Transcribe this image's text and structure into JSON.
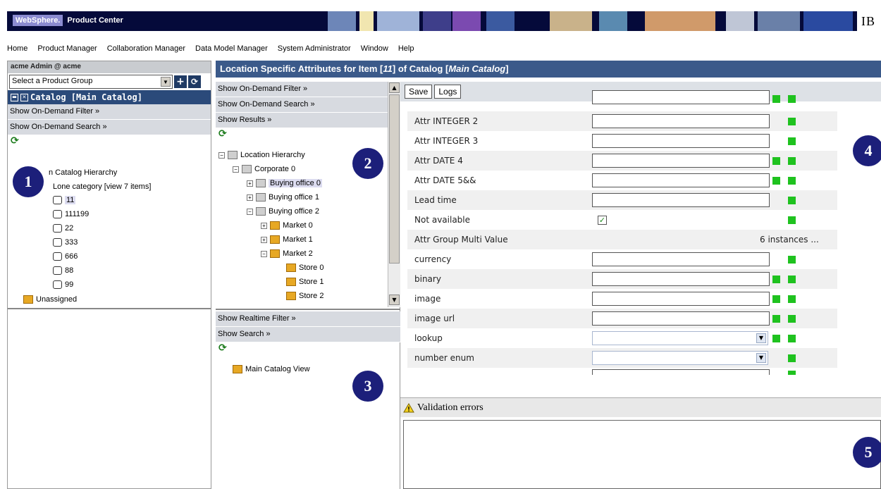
{
  "banner": {
    "brand": "WebSphere.",
    "product": "Product Center",
    "ibm": "IB"
  },
  "menu": [
    "Home",
    "Product Manager",
    "Collaboration Manager",
    "Data Model Manager",
    "System Administrator",
    "Window",
    "Help"
  ],
  "left": {
    "user": "acme Admin @ acme",
    "product_group_placeholder": "Select a Product Group",
    "catalog_title": "Catalog [Main Catalog]",
    "show_filter": "Show On-Demand Filter »",
    "show_search": "Show On-Demand Search »",
    "tree": {
      "root": "n Catalog Hierarchy",
      "category": "Lone category [view 7 items]",
      "items": [
        "11",
        "111199",
        "22",
        "333",
        "666",
        "88",
        "99"
      ],
      "unassigned": "Unassigned"
    }
  },
  "title": {
    "prefix": "Location Specific Attributes for Item [",
    "item": "11",
    "mid": "] of Catalog [",
    "catalog": "Main Catalog",
    "suffix": "]"
  },
  "mid": {
    "show_filter": "Show On-Demand Filter »",
    "show_search": "Show On-Demand Search »",
    "show_results": "Show Results »",
    "tree": {
      "root": "Location Hierarchy",
      "corporate": "Corporate 0",
      "offices": [
        "Buying office 0",
        "Buying office 1",
        "Buying office 2"
      ],
      "markets": [
        "Market 0",
        "Market 1",
        "Market 2"
      ],
      "stores": [
        "Store 0",
        "Store 1",
        "Store 2"
      ]
    },
    "show_realtime_filter": "Show Realtime Filter »",
    "show_search2": "Show Search »",
    "view": "Main Catalog View"
  },
  "toolbar": {
    "save": "Save",
    "logs": "Logs"
  },
  "attributes": [
    {
      "label": "Attr INTEGER 2",
      "type": "input"
    },
    {
      "label": "Attr INTEGER 3",
      "type": "input"
    },
    {
      "label": "Attr DATE 4",
      "type": "input"
    },
    {
      "label": "Attr DATE 5&&",
      "type": "input"
    },
    {
      "label": "Lead time",
      "type": "input"
    },
    {
      "label": "Not available",
      "type": "checkbox"
    },
    {
      "label": "Attr Group Multi Value",
      "type": "multi",
      "value": "6 instances ..."
    },
    {
      "label": "currency",
      "type": "input"
    },
    {
      "label": "binary",
      "type": "input"
    },
    {
      "label": "image",
      "type": "input"
    },
    {
      "label": "image url",
      "type": "input"
    },
    {
      "label": "lookup",
      "type": "select"
    },
    {
      "label": "number enum",
      "type": "select"
    }
  ],
  "validation": {
    "title": "Validation errors"
  },
  "badges": [
    "1",
    "2",
    "3",
    "4",
    "5"
  ],
  "colors": {
    "accent": "#1c1f7a",
    "status_green": "#1fc21f",
    "title_bar": "#3b5a8a"
  }
}
